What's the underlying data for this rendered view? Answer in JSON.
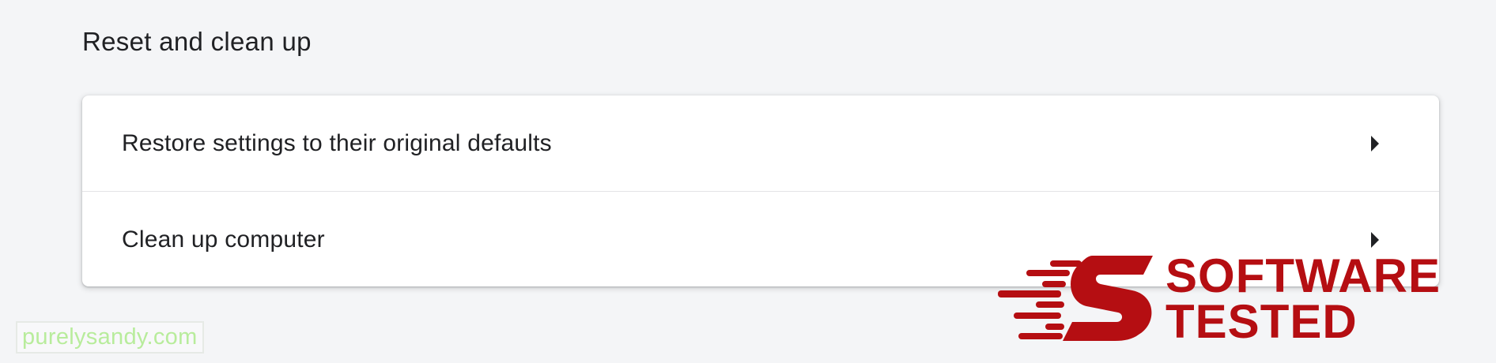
{
  "section": {
    "title": "Reset and clean up"
  },
  "rows": [
    {
      "label": "Restore settings to their original defaults",
      "icon": "chevron-right-icon"
    },
    {
      "label": "Clean up computer",
      "icon": "chevron-right-icon"
    }
  ],
  "watermark": {
    "text": "purelysandy.com",
    "color": "#b8ec9c"
  },
  "logo": {
    "line1": "SOFTWARE",
    "line2": "TESTED",
    "color": "#b50e12"
  }
}
